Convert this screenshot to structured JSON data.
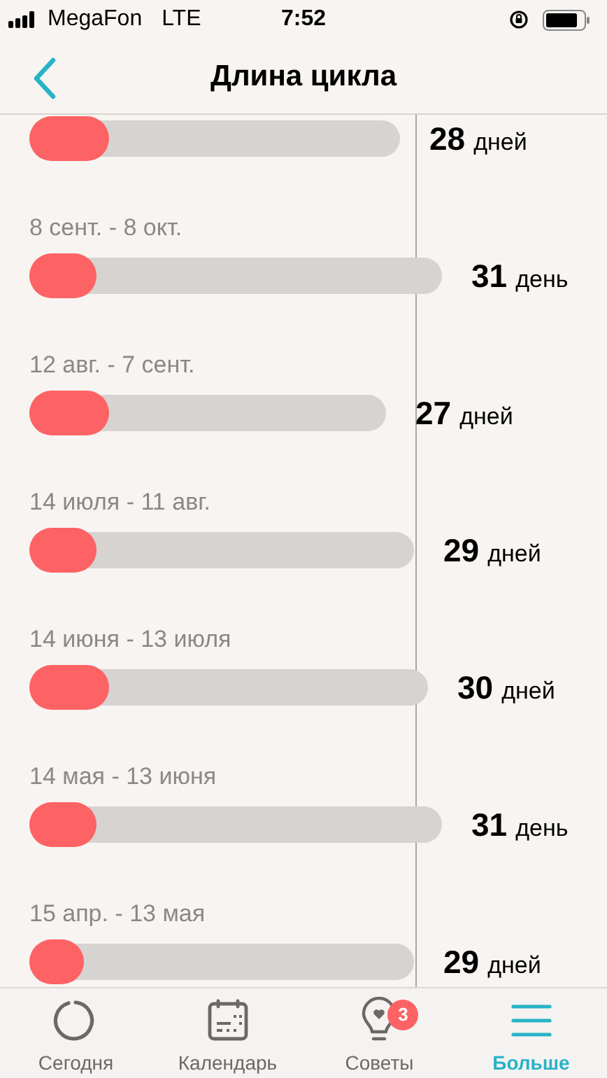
{
  "status_bar": {
    "carrier": "MegaFon",
    "network": "LTE",
    "time": "7:52"
  },
  "header": {
    "title": "Длина цикла"
  },
  "cycles": [
    {
      "period": {
        "level": 0.214
      },
      "count": "28",
      "unit": "дней"
    },
    {
      "dates": "8 сент. - 8 окт.",
      "period": {
        "level": 0.163
      },
      "count": "31",
      "unit": "день"
    },
    {
      "dates": "12 авг. - 7 сент.",
      "period": {
        "level": 0.223
      },
      "count": "27",
      "unit": "дней"
    },
    {
      "dates": "14 июля - 11 авг.",
      "period": {
        "level": 0.174
      },
      "count": "29",
      "unit": "дней"
    },
    {
      "dates": "14 июня - 13 июля",
      "period": {
        "level": 0.199
      },
      "count": "30",
      "unit": "дней"
    },
    {
      "dates": "14 мая - 13 июня",
      "period": {
        "level": 0.163
      },
      "count": "31",
      "unit": "день"
    },
    {
      "dates": "15 апр. - 13 мая",
      "period": {
        "level": 0.141
      },
      "count": "29",
      "unit": "дней"
    }
  ],
  "tab_bar": [
    {
      "kind": "today",
      "label": "Сегодня",
      "selected": false
    },
    {
      "kind": "calendar",
      "label": "Календарь",
      "selected": false
    },
    {
      "kind": "tips",
      "label": "Советы",
      "selected": false,
      "badge": "3"
    },
    {
      "kind": "more",
      "label": "Больше",
      "selected": true
    }
  ]
}
